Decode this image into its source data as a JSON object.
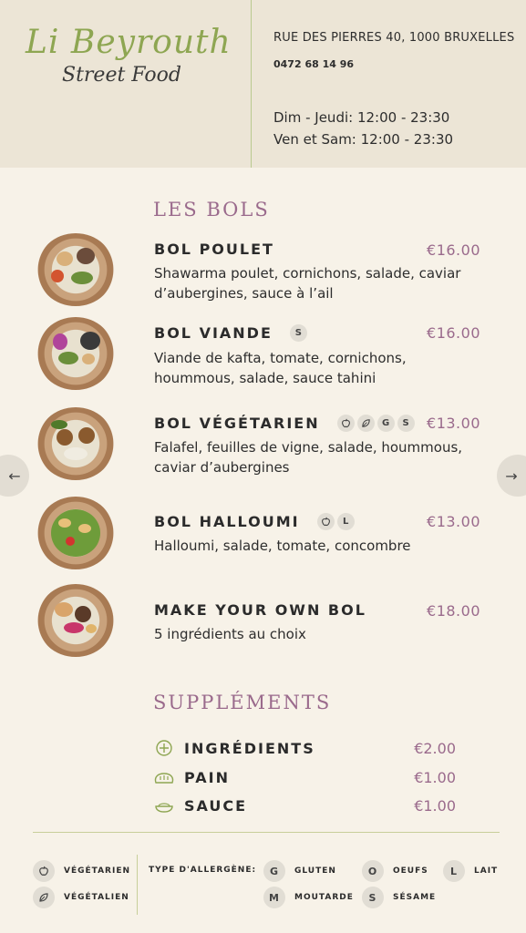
{
  "header": {
    "logo_main": "Li Beyrouth",
    "logo_sub": "Street Food",
    "address": "RUE DES PIERRES 40, 1000 BRUXELLES",
    "phone": "0472 68 14 96",
    "hours_line1": "Dim - Jeudi: 12:00 - 23:30",
    "hours_line2": "Ven et Sam: 12:00 - 23:30"
  },
  "nav": {
    "prev_icon": "←",
    "next_icon": "→"
  },
  "bols": {
    "title": "LES BOLS",
    "items": [
      {
        "name": "BOL POULET",
        "price": "€16.00",
        "desc": "Shawarma poulet, cornichons, salade, caviar d’aubergines, sauce à l’ail",
        "badges": []
      },
      {
        "name": "BOL VIANDE",
        "price": "€16.00",
        "desc": "Viande de kafta, tomate, cornichons, hoummous, salade, sauce tahini",
        "badges": [
          "S"
        ]
      },
      {
        "name": "BOL VÉGÉTARIEN",
        "price": "€13.00",
        "desc": "Falafel, feuilles de vigne, salade, hoummous, caviar d’aubergines",
        "badges": [
          "apple-icon",
          "leaf-icon",
          "G",
          "S"
        ]
      },
      {
        "name": "BOL HALLOUMI",
        "price": "€13.00",
        "desc": "Halloumi, salade, tomate, concombre",
        "badges": [
          "apple-icon",
          "L"
        ]
      },
      {
        "name": "MAKE YOUR OWN BOL",
        "price": "€18.00",
        "desc": "5 ingrédients au choix",
        "badges": []
      }
    ]
  },
  "supplements": {
    "title": "SUPPLÉMENTS",
    "items": [
      {
        "icon": "plus-circle-icon",
        "label": "INGRÉDIENTS",
        "price": "€2.00"
      },
      {
        "icon": "bread-icon",
        "label": "PAIN",
        "price": "€1.00"
      },
      {
        "icon": "sauce-bowl-icon",
        "label": "SAUCE",
        "price": "€1.00"
      }
    ]
  },
  "legend": {
    "vegetarian": "VÉGÉTARIEN",
    "vegan": "VÉGÉTALIEN",
    "allergen_title": "TYPE D'ALLERGÈNE:",
    "gluten_letter": "G",
    "gluten": "GLUTEN",
    "eggs_letter": "O",
    "eggs": "OEUFS",
    "milk_letter": "L",
    "milk": "LAIT",
    "mustard_letter": "M",
    "mustard": "MOUTARDE",
    "sesame_letter": "S",
    "sesame": "SÉSAME"
  },
  "colors": {
    "accent_green": "#8ea652",
    "accent_purple": "#9a6a8c",
    "background": "#f7f2e8",
    "header_bg": "#ece5d6"
  }
}
